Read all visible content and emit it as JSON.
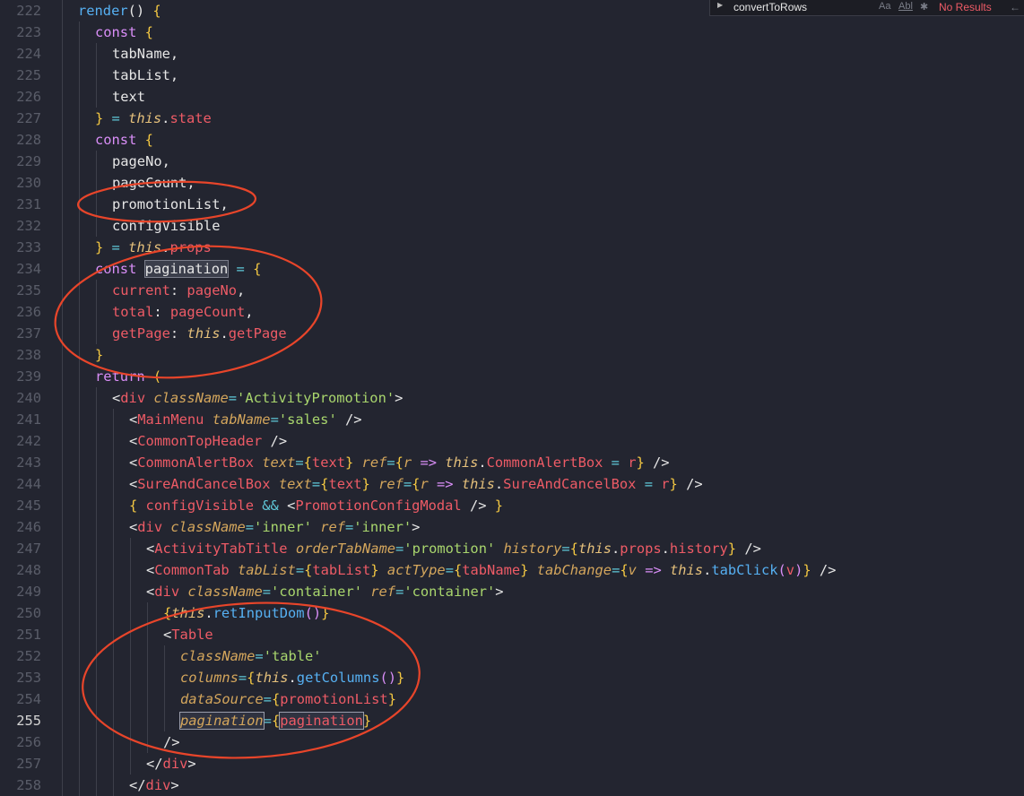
{
  "findbar": {
    "query": "convertToRows",
    "case_label": "Aa",
    "word_label": "Abl",
    "regex_glyph": "✱",
    "result": "No Results",
    "prev_arrow": "←"
  },
  "active_line": 255,
  "lines": [
    {
      "n": 222,
      "indent": 1,
      "tokens": [
        [
          "fn",
          "render"
        ],
        [
          "pl",
          "() "
        ],
        [
          "br",
          "{"
        ]
      ]
    },
    {
      "n": 223,
      "indent": 2,
      "tokens": [
        [
          "kw",
          "const "
        ],
        [
          "br",
          "{"
        ]
      ]
    },
    {
      "n": 224,
      "indent": 3,
      "tokens": [
        [
          "pl",
          "tabName,"
        ]
      ]
    },
    {
      "n": 225,
      "indent": 3,
      "tokens": [
        [
          "pl",
          "tabList,"
        ]
      ]
    },
    {
      "n": 226,
      "indent": 3,
      "tokens": [
        [
          "pl",
          "text"
        ]
      ]
    },
    {
      "n": 227,
      "indent": 2,
      "tokens": [
        [
          "br",
          "}"
        ],
        [
          "op",
          " = "
        ],
        [
          "th",
          "this"
        ],
        [
          "pl",
          "."
        ],
        [
          "pr",
          "state"
        ]
      ]
    },
    {
      "n": 228,
      "indent": 2,
      "tokens": [
        [
          "kw",
          "const "
        ],
        [
          "br",
          "{"
        ]
      ]
    },
    {
      "n": 229,
      "indent": 3,
      "tokens": [
        [
          "pl",
          "pageNo,"
        ]
      ]
    },
    {
      "n": 230,
      "indent": 3,
      "tokens": [
        [
          "pl",
          "pageCount,"
        ]
      ]
    },
    {
      "n": 231,
      "indent": 3,
      "tokens": [
        [
          "pl",
          "promotionList,"
        ]
      ]
    },
    {
      "n": 232,
      "indent": 3,
      "tokens": [
        [
          "pl",
          "configVisible"
        ]
      ]
    },
    {
      "n": 233,
      "indent": 2,
      "tokens": [
        [
          "br",
          "}"
        ],
        [
          "op",
          " = "
        ],
        [
          "th",
          "this"
        ],
        [
          "pl",
          "."
        ],
        [
          "pr",
          "props"
        ]
      ]
    },
    {
      "n": 234,
      "indent": 2,
      "tokens": [
        [
          "kw",
          "const "
        ],
        [
          "hl",
          "pagination"
        ],
        [
          "op",
          " = "
        ],
        [
          "br",
          "{"
        ]
      ]
    },
    {
      "n": 235,
      "indent": 3,
      "tokens": [
        [
          "pr",
          "current"
        ],
        [
          "pl",
          ": "
        ],
        [
          "pr",
          "pageNo"
        ],
        [
          "pl",
          ","
        ]
      ]
    },
    {
      "n": 236,
      "indent": 3,
      "tokens": [
        [
          "pr",
          "total"
        ],
        [
          "pl",
          ": "
        ],
        [
          "pr",
          "pageCount"
        ],
        [
          "pl",
          ","
        ]
      ]
    },
    {
      "n": 237,
      "indent": 3,
      "tokens": [
        [
          "pr",
          "getPage"
        ],
        [
          "pl",
          ": "
        ],
        [
          "th",
          "this"
        ],
        [
          "pl",
          "."
        ],
        [
          "pr",
          "getPage"
        ]
      ]
    },
    {
      "n": 238,
      "indent": 2,
      "tokens": [
        [
          "br",
          "}"
        ]
      ]
    },
    {
      "n": 239,
      "indent": 2,
      "tokens": [
        [
          "kw",
          "return "
        ],
        [
          "br",
          "("
        ]
      ]
    },
    {
      "n": 240,
      "indent": 3,
      "tokens": [
        [
          "pl",
          "<"
        ],
        [
          "tg",
          "div"
        ],
        [
          "at",
          " className"
        ],
        [
          "op",
          "="
        ],
        [
          "st",
          "'ActivityPromotion'"
        ],
        [
          "pl",
          ">"
        ]
      ]
    },
    {
      "n": 241,
      "indent": 4,
      "tokens": [
        [
          "pl",
          "<"
        ],
        [
          "tg",
          "MainMenu"
        ],
        [
          "at",
          " tabName"
        ],
        [
          "op",
          "="
        ],
        [
          "st",
          "'sales'"
        ],
        [
          "pl",
          " />"
        ]
      ]
    },
    {
      "n": 242,
      "indent": 4,
      "tokens": [
        [
          "pl",
          "<"
        ],
        [
          "tg",
          "CommonTopHeader"
        ],
        [
          "pl",
          " />"
        ]
      ]
    },
    {
      "n": 243,
      "indent": 4,
      "tokens": [
        [
          "pl",
          "<"
        ],
        [
          "tg",
          "CommonAlertBox"
        ],
        [
          "at",
          " text"
        ],
        [
          "op",
          "="
        ],
        [
          "br",
          "{"
        ],
        [
          "pr",
          "text"
        ],
        [
          "br",
          "}"
        ],
        [
          "at",
          " ref"
        ],
        [
          "op",
          "="
        ],
        [
          "br",
          "{"
        ],
        [
          "at",
          "r"
        ],
        [
          "kw",
          " => "
        ],
        [
          "th",
          "this"
        ],
        [
          "pl",
          "."
        ],
        [
          "pr",
          "CommonAlertBox"
        ],
        [
          "op",
          " = "
        ],
        [
          "pr",
          "r"
        ],
        [
          "br",
          "}"
        ],
        [
          "pl",
          " />"
        ]
      ]
    },
    {
      "n": 244,
      "indent": 4,
      "tokens": [
        [
          "pl",
          "<"
        ],
        [
          "tg",
          "SureAndCancelBox"
        ],
        [
          "at",
          " text"
        ],
        [
          "op",
          "="
        ],
        [
          "br",
          "{"
        ],
        [
          "pr",
          "text"
        ],
        [
          "br",
          "}"
        ],
        [
          "at",
          " ref"
        ],
        [
          "op",
          "="
        ],
        [
          "br",
          "{"
        ],
        [
          "at",
          "r"
        ],
        [
          "kw",
          " => "
        ],
        [
          "th",
          "this"
        ],
        [
          "pl",
          "."
        ],
        [
          "pr",
          "SureAndCancelBox"
        ],
        [
          "op",
          " = "
        ],
        [
          "pr",
          "r"
        ],
        [
          "br",
          "}"
        ],
        [
          "pl",
          " />"
        ]
      ]
    },
    {
      "n": 245,
      "indent": 4,
      "tokens": [
        [
          "br",
          "{ "
        ],
        [
          "pr",
          "configVisible"
        ],
        [
          "op",
          " && "
        ],
        [
          "pl",
          "<"
        ],
        [
          "tg",
          "PromotionConfigModal"
        ],
        [
          "pl",
          " /> "
        ],
        [
          "br",
          "}"
        ]
      ]
    },
    {
      "n": 246,
      "indent": 4,
      "tokens": [
        [
          "pl",
          "<"
        ],
        [
          "tg",
          "div"
        ],
        [
          "at",
          " className"
        ],
        [
          "op",
          "="
        ],
        [
          "st",
          "'inner'"
        ],
        [
          "at",
          " ref"
        ],
        [
          "op",
          "="
        ],
        [
          "st",
          "'inner'"
        ],
        [
          "pl",
          ">"
        ]
      ]
    },
    {
      "n": 247,
      "indent": 5,
      "tokens": [
        [
          "pl",
          "<"
        ],
        [
          "tg",
          "ActivityTabTitle"
        ],
        [
          "at",
          " orderTabName"
        ],
        [
          "op",
          "="
        ],
        [
          "st",
          "'promotion'"
        ],
        [
          "at",
          " history"
        ],
        [
          "op",
          "="
        ],
        [
          "br",
          "{"
        ],
        [
          "th",
          "this"
        ],
        [
          "pl",
          "."
        ],
        [
          "pr",
          "props"
        ],
        [
          "pl",
          "."
        ],
        [
          "pr",
          "history"
        ],
        [
          "br",
          "}"
        ],
        [
          "pl",
          " />"
        ]
      ]
    },
    {
      "n": 248,
      "indent": 5,
      "tokens": [
        [
          "pl",
          "<"
        ],
        [
          "tg",
          "CommonTab"
        ],
        [
          "at",
          " tabList"
        ],
        [
          "op",
          "="
        ],
        [
          "br",
          "{"
        ],
        [
          "pr",
          "tabList"
        ],
        [
          "br",
          "}"
        ],
        [
          "at",
          " actType"
        ],
        [
          "op",
          "="
        ],
        [
          "br",
          "{"
        ],
        [
          "pr",
          "tabName"
        ],
        [
          "br",
          "}"
        ],
        [
          "at",
          " tabChange"
        ],
        [
          "op",
          "="
        ],
        [
          "br",
          "{"
        ],
        [
          "at",
          "v"
        ],
        [
          "kw",
          " => "
        ],
        [
          "th",
          "this"
        ],
        [
          "pl",
          "."
        ],
        [
          "fn",
          "tabClick"
        ],
        [
          "kw",
          "("
        ],
        [
          "pr",
          "v"
        ],
        [
          "kw",
          ")"
        ],
        [
          "br",
          "}"
        ],
        [
          "pl",
          " />"
        ]
      ]
    },
    {
      "n": 249,
      "indent": 5,
      "tokens": [
        [
          "pl",
          "<"
        ],
        [
          "tg",
          "div"
        ],
        [
          "at",
          " className"
        ],
        [
          "op",
          "="
        ],
        [
          "st",
          "'container'"
        ],
        [
          "at",
          " ref"
        ],
        [
          "op",
          "="
        ],
        [
          "st",
          "'container'"
        ],
        [
          "pl",
          ">"
        ]
      ]
    },
    {
      "n": 250,
      "indent": 6,
      "tokens": [
        [
          "br",
          "{"
        ],
        [
          "th",
          "this"
        ],
        [
          "pl",
          "."
        ],
        [
          "fn",
          "retInputDom"
        ],
        [
          "kw",
          "()"
        ],
        [
          "br",
          "}"
        ]
      ]
    },
    {
      "n": 251,
      "indent": 6,
      "tokens": [
        [
          "pl",
          "<"
        ],
        [
          "tg",
          "Table"
        ]
      ]
    },
    {
      "n": 252,
      "indent": 7,
      "tokens": [
        [
          "at",
          "className"
        ],
        [
          "op",
          "="
        ],
        [
          "st",
          "'table'"
        ]
      ]
    },
    {
      "n": 253,
      "indent": 7,
      "tokens": [
        [
          "at",
          "columns"
        ],
        [
          "op",
          "="
        ],
        [
          "br",
          "{"
        ],
        [
          "th",
          "this"
        ],
        [
          "pl",
          "."
        ],
        [
          "fn",
          "getColumns"
        ],
        [
          "kw",
          "()"
        ],
        [
          "br",
          "}"
        ]
      ]
    },
    {
      "n": 254,
      "indent": 7,
      "tokens": [
        [
          "at",
          "dataSource"
        ],
        [
          "op",
          "="
        ],
        [
          "br",
          "{"
        ],
        [
          "pr",
          "promotionList"
        ],
        [
          "br",
          "}"
        ]
      ]
    },
    {
      "n": 255,
      "indent": 7,
      "tokens": [
        [
          "hl2at",
          "pagination"
        ],
        [
          "op",
          "="
        ],
        [
          "br",
          "{"
        ],
        [
          "hl2pr",
          "pagination"
        ],
        [
          "br",
          "}"
        ]
      ]
    },
    {
      "n": 256,
      "indent": 6,
      "tokens": [
        [
          "pl",
          "/>"
        ]
      ]
    },
    {
      "n": 257,
      "indent": 5,
      "tokens": [
        [
          "pl",
          "</"
        ],
        [
          "tg",
          "div"
        ],
        [
          "pl",
          ">"
        ]
      ]
    },
    {
      "n": 258,
      "indent": 4,
      "tokens": [
        [
          "pl",
          "</"
        ],
        [
          "tg",
          "div"
        ],
        [
          "pl",
          ">"
        ]
      ]
    }
  ]
}
